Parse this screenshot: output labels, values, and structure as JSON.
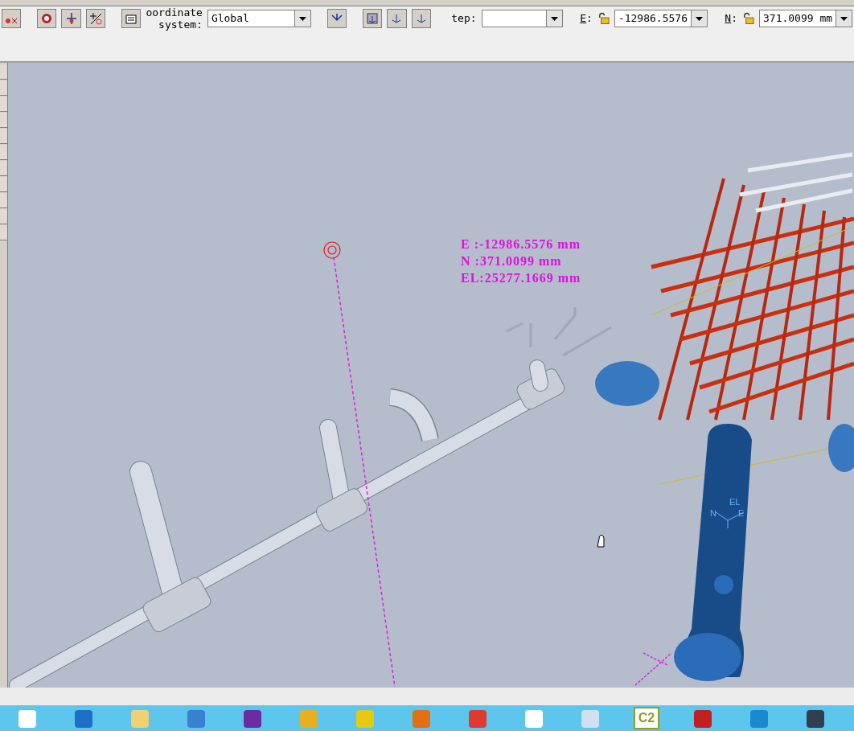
{
  "toolbar": {
    "coordinate_label_lines": [
      "oordinate",
      "system:"
    ],
    "coordinate_system": "Global",
    "step_label": "tep:",
    "e_label": "E:",
    "e_value": "-12986.5576",
    "n_label": "N:",
    "n_value": "371.0099 mm"
  },
  "viewport": {
    "readout": [
      "E :-12986.5576 mm",
      "N :371.0099 mm",
      "EL:25277.1669 mm"
    ],
    "axis_labels": [
      "N",
      "EL",
      "E"
    ]
  },
  "taskbar": {
    "app_badge": "C2"
  }
}
